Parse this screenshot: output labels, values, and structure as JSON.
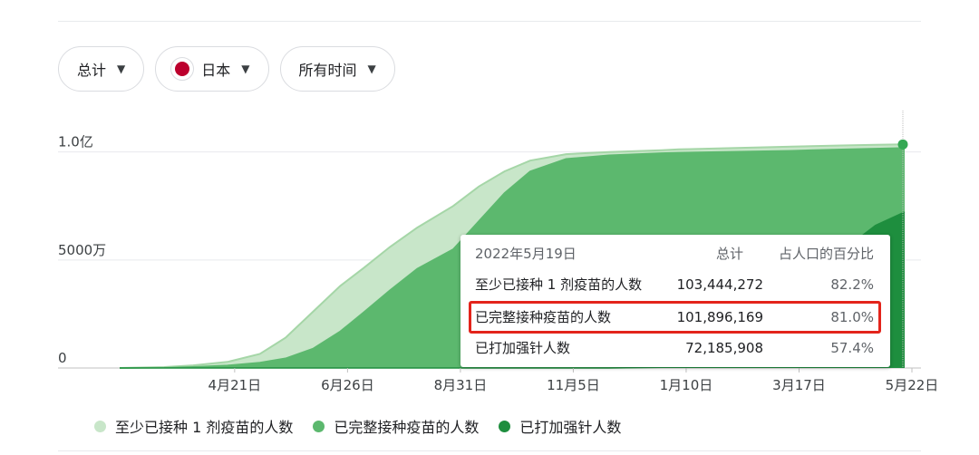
{
  "filters": {
    "metric": "总计",
    "country": "日本",
    "range": "所有时间"
  },
  "colors": {
    "dose1": "#c8e6c9",
    "dose1_line": "#a5d6a7",
    "full": "#5cb86e",
    "full_marker": "#34a853",
    "booster": "#1e8e3e",
    "highlight": "#e3241b"
  },
  "tooltip": {
    "date": "2022年5月19日",
    "col_total": "总计",
    "col_pct": "占人口的百分比",
    "rows": [
      {
        "label": "至少已接种 1 剂疫苗的人数",
        "total": "103,444,272",
        "pct": "82.2%"
      },
      {
        "label": "已完整接种疫苗的人数",
        "total": "101,896,169",
        "pct": "81.0%"
      },
      {
        "label": "已打加强针人数",
        "total": "72,185,908",
        "pct": "57.4%"
      }
    ]
  },
  "chart_data": {
    "type": "area",
    "title": "",
    "xlabel": "",
    "ylabel": "",
    "x_ticks": [
      "4月21日",
      "6月26日",
      "8月31日",
      "11月5日",
      "1月10日",
      "3月17日",
      "5月22日"
    ],
    "y_ticks": [
      {
        "value": 0,
        "label": "0"
      },
      {
        "value": 50000000,
        "label": "5000万"
      },
      {
        "value": 100000000,
        "label": "1.0亿"
      }
    ],
    "ylim": [
      0,
      120000000
    ],
    "x": [
      "2021-02-17",
      "2021-03-15",
      "2021-04-01",
      "2021-04-21",
      "2021-05-10",
      "2021-05-25",
      "2021-06-10",
      "2021-06-26",
      "2021-07-10",
      "2021-07-25",
      "2021-08-10",
      "2021-08-31",
      "2021-09-15",
      "2021-09-30",
      "2021-10-15",
      "2021-11-05",
      "2021-11-30",
      "2021-12-31",
      "2022-01-10",
      "2022-02-10",
      "2022-03-17",
      "2022-04-15",
      "2022-05-05",
      "2022-05-22"
    ],
    "series": [
      {
        "name": "至少已接种 1 剂疫苗的人数",
        "values": [
          0,
          0.4,
          1.2,
          2.8,
          6.5,
          14,
          26,
          38,
          46.5,
          56,
          65,
          75,
          84,
          91,
          96,
          99,
          100,
          100.8,
          101.2,
          101.8,
          102.5,
          103,
          103.3,
          103.5
        ]
      },
      {
        "name": "已完整接种疫苗的人数",
        "values": [
          0,
          0.1,
          0.5,
          1.2,
          2.5,
          4.5,
          9,
          17,
          26,
          36,
          46,
          55,
          68,
          81,
          91,
          96.8,
          98.5,
          99.5,
          99.7,
          100.1,
          100.6,
          101.2,
          101.6,
          101.9
        ]
      },
      {
        "name": "已打加强针人数",
        "values": [
          0,
          0,
          0,
          0,
          0,
          0,
          0,
          0,
          0,
          0,
          0,
          0,
          0,
          0,
          0,
          0,
          0,
          0.3,
          0.8,
          8,
          35,
          54,
          66,
          72.2
        ]
      }
    ],
    "legend_position": "bottom"
  }
}
